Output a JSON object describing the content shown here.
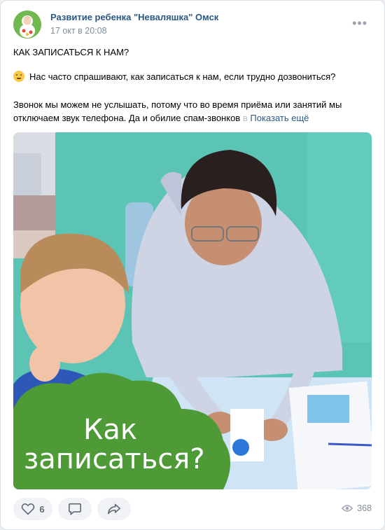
{
  "post": {
    "author": "Развитие ребенка \"Неваляшка\" Омск",
    "date": "17 окт в 20:08",
    "heading": "КАК ЗАПИСАТЬСЯ К НАМ?",
    "line1": "Нас часто спрашивают, как записаться к нам, если трудно дозвониться?",
    "line2": "Звонок мы можем не услышать, потому что во время приёма или занятий мы",
    "line3": "отключаем звук телефона. Да и обилие спам-звонков",
    "line3_fade": "в",
    "show_more": "Показать ещё"
  },
  "image": {
    "caption_line1": "Как",
    "caption_line2": "записаться?"
  },
  "actions": {
    "likes": "6",
    "views": "368"
  },
  "icons": {
    "like": "heart-icon",
    "comment": "comment-icon",
    "share": "share-icon",
    "views": "eye-icon",
    "more": "more-dots-icon",
    "emoji": "thinking-face-icon"
  },
  "colors": {
    "link": "#2a5885",
    "meta": "#818c99",
    "brand_green": "#4d9a37"
  }
}
